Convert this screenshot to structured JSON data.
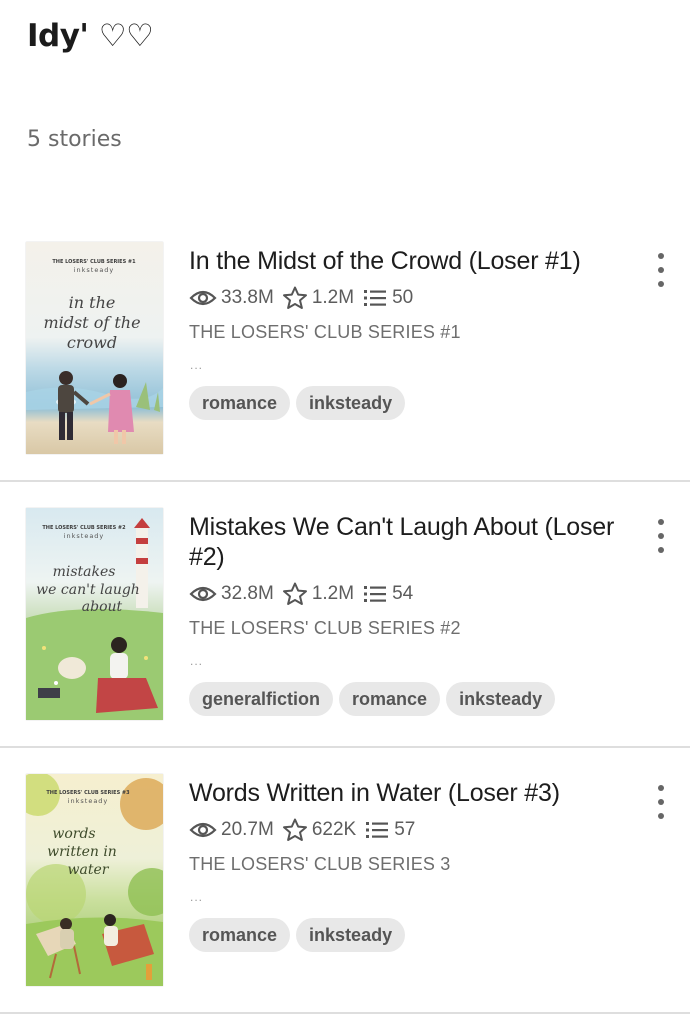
{
  "header": {
    "title": "Idy' ♡♡",
    "story_count": "5 stories"
  },
  "stories": [
    {
      "title": "In the Midst of the Crowd (Loser #1)",
      "reads": "33.8M",
      "votes": "1.2M",
      "parts": "50",
      "description": "THE LOSERS' CLUB SERIES #1",
      "ellipsis": "...",
      "tags": [
        "romance",
        "inksteady"
      ],
      "cover": {
        "series": "THE LOSERS' CLUB SERIES #1",
        "author": "inksteady",
        "script_lines": [
          "in the",
          "midst of the",
          "crowd"
        ]
      }
    },
    {
      "title": "Mistakes We Can't Laugh About (Loser #2)",
      "reads": "32.8M",
      "votes": "1.2M",
      "parts": "54",
      "description": "THE LOSERS' CLUB SERIES #2",
      "ellipsis": "...",
      "tags": [
        "generalfiction",
        "romance",
        "inksteady"
      ],
      "cover": {
        "series": "THE LOSERS' CLUB SERIES #2",
        "author": "inksteady",
        "script_lines": [
          "mistakes",
          "we can't laugh",
          "about"
        ]
      }
    },
    {
      "title": "Words Written in Water (Loser #3)",
      "reads": "20.7M",
      "votes": "622K",
      "parts": "57",
      "description": "THE LOSERS' CLUB SERIES 3",
      "ellipsis": "...",
      "tags": [
        "romance",
        "inksteady"
      ],
      "cover": {
        "series": "THE LOSERS' CLUB SERIES #3",
        "author": "inksteady",
        "script_lines": [
          "words",
          "written in",
          "water"
        ]
      }
    }
  ],
  "icons": {
    "reads": "eye-icon",
    "votes": "star-icon",
    "parts": "list-icon",
    "more": "more-vertical-icon"
  },
  "colors": {
    "tag_background": "#e8e8e8",
    "divider": "#dedede",
    "meta_text": "#5c5c5c"
  }
}
